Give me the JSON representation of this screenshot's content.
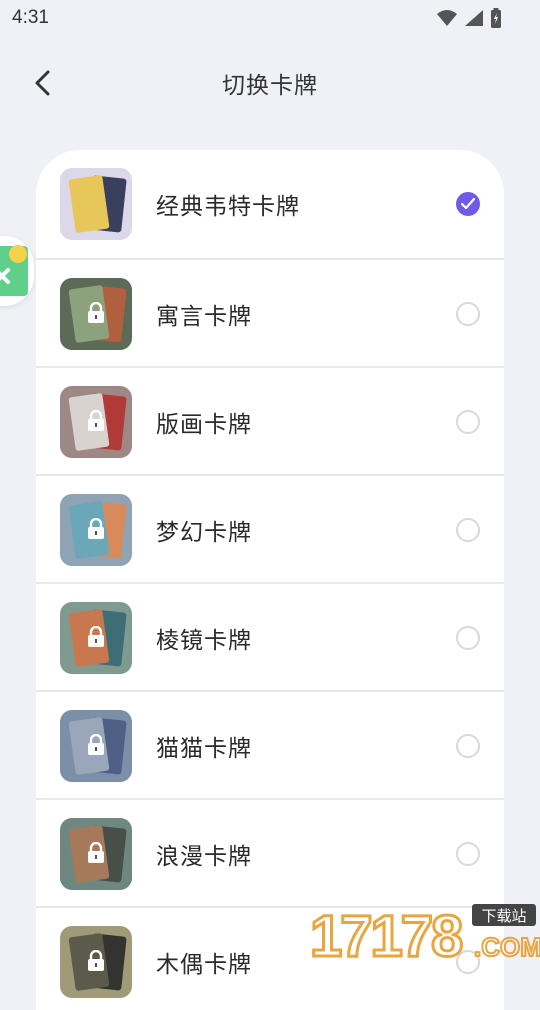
{
  "status": {
    "time": "4:31"
  },
  "header": {
    "title": "切换卡牌"
  },
  "decks": [
    {
      "label": "经典韦特卡牌",
      "selected": true,
      "locked": false,
      "bg": "#dcd8ea",
      "card_a": "#e8c75a",
      "card_b": "#3a3f5e"
    },
    {
      "label": "寓言卡牌",
      "selected": false,
      "locked": true,
      "bg": "#5b6b58",
      "card_a": "#8ba27d",
      "card_b": "#b0603f"
    },
    {
      "label": "版画卡牌",
      "selected": false,
      "locked": true,
      "bg": "#9d8886",
      "card_a": "#d8d3cf",
      "card_b": "#b23a36"
    },
    {
      "label": "梦幻卡牌",
      "selected": false,
      "locked": true,
      "bg": "#8fa3b5",
      "card_a": "#6aa7b8",
      "card_b": "#d98a5b"
    },
    {
      "label": "棱镜卡牌",
      "selected": false,
      "locked": true,
      "bg": "#7f9a8f",
      "card_a": "#c9774f",
      "card_b": "#3e6d76"
    },
    {
      "label": "猫猫卡牌",
      "selected": false,
      "locked": true,
      "bg": "#7c8fa8",
      "card_a": "#9aa6b9",
      "card_b": "#4f5f86"
    },
    {
      "label": "浪漫卡牌",
      "selected": false,
      "locked": true,
      "bg": "#6e8880",
      "card_a": "#a6795b",
      "card_b": "#465049"
    },
    {
      "label": "木偶卡牌",
      "selected": false,
      "locked": true,
      "bg": "#a09a78",
      "card_a": "#5c5a4a",
      "card_b": "#333330"
    }
  ],
  "colors": {
    "accent": "#6e5ce6",
    "background": "#f0f1f6"
  },
  "watermark": {
    "number": "17178",
    "tag": "下载站",
    "domain": ".COM"
  }
}
